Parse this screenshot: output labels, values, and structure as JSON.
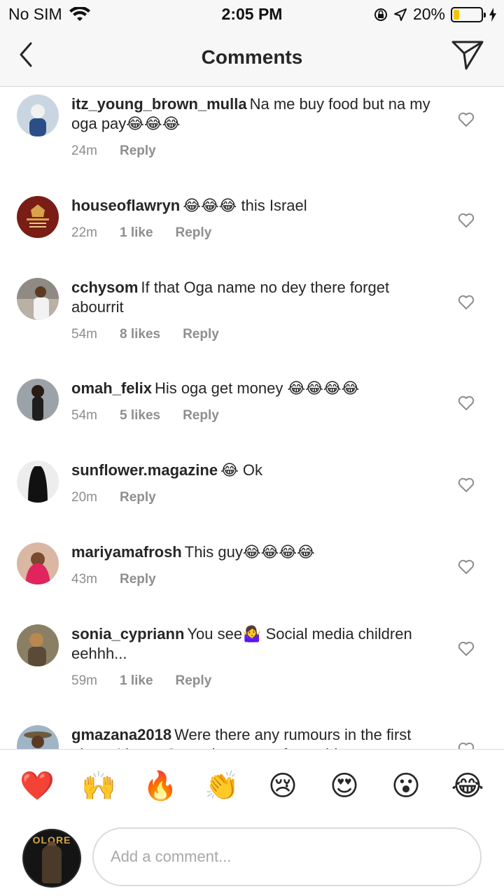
{
  "status_bar": {
    "carrier": "No SIM",
    "time": "2:05 PM",
    "battery": "20%",
    "battery_level": 0.2,
    "battery_color": "#f5c400"
  },
  "nav": {
    "title": "Comments",
    "back_icon": "chevron-left-icon",
    "send_icon": "paper-plane-icon"
  },
  "comments": [
    {
      "username": "itz_young_brown_mulla",
      "text": "Na me buy food but na my oga pay😂😂😂",
      "time": "24m",
      "likes": "",
      "reply": "Reply"
    },
    {
      "username": "houseoflawryn",
      "text": "😂😂😂 this Israel",
      "time": "22m",
      "likes": "1 like",
      "reply": "Reply"
    },
    {
      "username": "cchysom",
      "text": "If that Oga name no dey there forget abourrit",
      "time": "54m",
      "likes": "8 likes",
      "reply": "Reply"
    },
    {
      "username": "omah_felix",
      "text": "His oga get money 😂😂😂😂",
      "time": "54m",
      "likes": "5 likes",
      "reply": "Reply"
    },
    {
      "username": "sunflower.magazine",
      "text": "😂 Ok",
      "time": "20m",
      "likes": "",
      "reply": "Reply"
    },
    {
      "username": "mariyamafrosh",
      "text": "This guy😂😂😂😂",
      "time": "43m",
      "likes": "",
      "reply": "Reply"
    },
    {
      "username": "sonia_cypriann",
      "text": "You see🤷‍♀️ Social media children eehhh...",
      "time": "59m",
      "likes": "1 like",
      "reply": "Reply"
    },
    {
      "username": "gmazana2018",
      "text": "Were there any rumours in the first place. I know Oga takes care of me, this",
      "time": "",
      "likes": "",
      "reply": ""
    }
  ],
  "emoji_bar": [
    "❤️",
    "🙌",
    "🔥",
    "👏",
    "😢",
    "😍",
    "😮",
    "😂"
  ],
  "composer": {
    "placeholder": "Add a comment...",
    "avatar_text": "OLORE"
  }
}
